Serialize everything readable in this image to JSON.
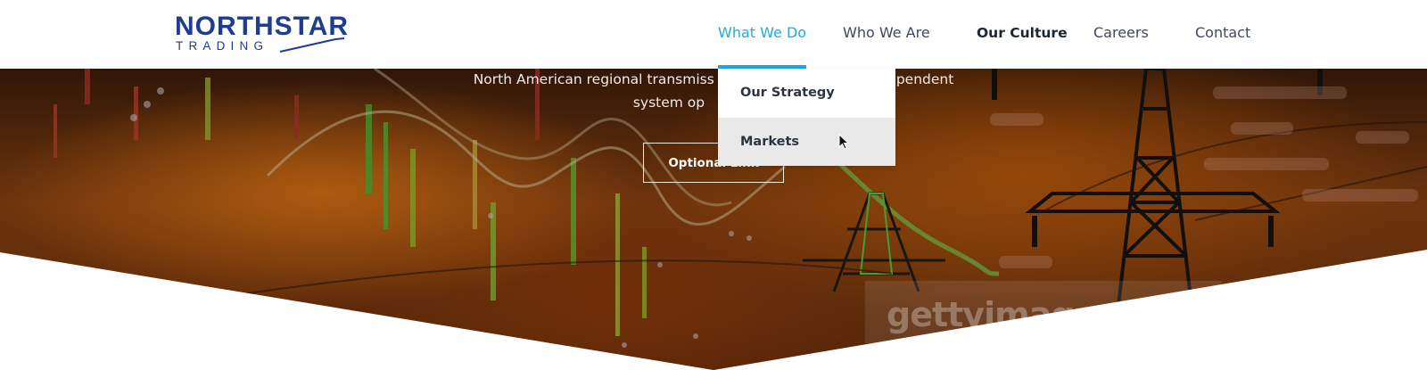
{
  "logo": {
    "top": "NORTHSTAR",
    "bottom": "TRADING"
  },
  "nav": {
    "items": [
      {
        "label": "What We Do",
        "state": "active"
      },
      {
        "label": "Who We Are",
        "state": "normal"
      },
      {
        "label": "Our Culture",
        "state": "bold"
      },
      {
        "label": "Careers",
        "state": "normal"
      },
      {
        "label": "Contact",
        "state": "normal"
      }
    ]
  },
  "dropdown": {
    "items": [
      {
        "label": "Our Strategy"
      },
      {
        "label": "Markets"
      }
    ]
  },
  "hero": {
    "line1": "North American regional transmiss",
    "line1_right": "pendent",
    "line2": "system op",
    "button_label": "Optional Link",
    "watermark": "gettyimages"
  },
  "colors": {
    "brand": "#1f3d8f",
    "accent": "#25a9dd",
    "hover_bg": "#e9e9e9"
  }
}
